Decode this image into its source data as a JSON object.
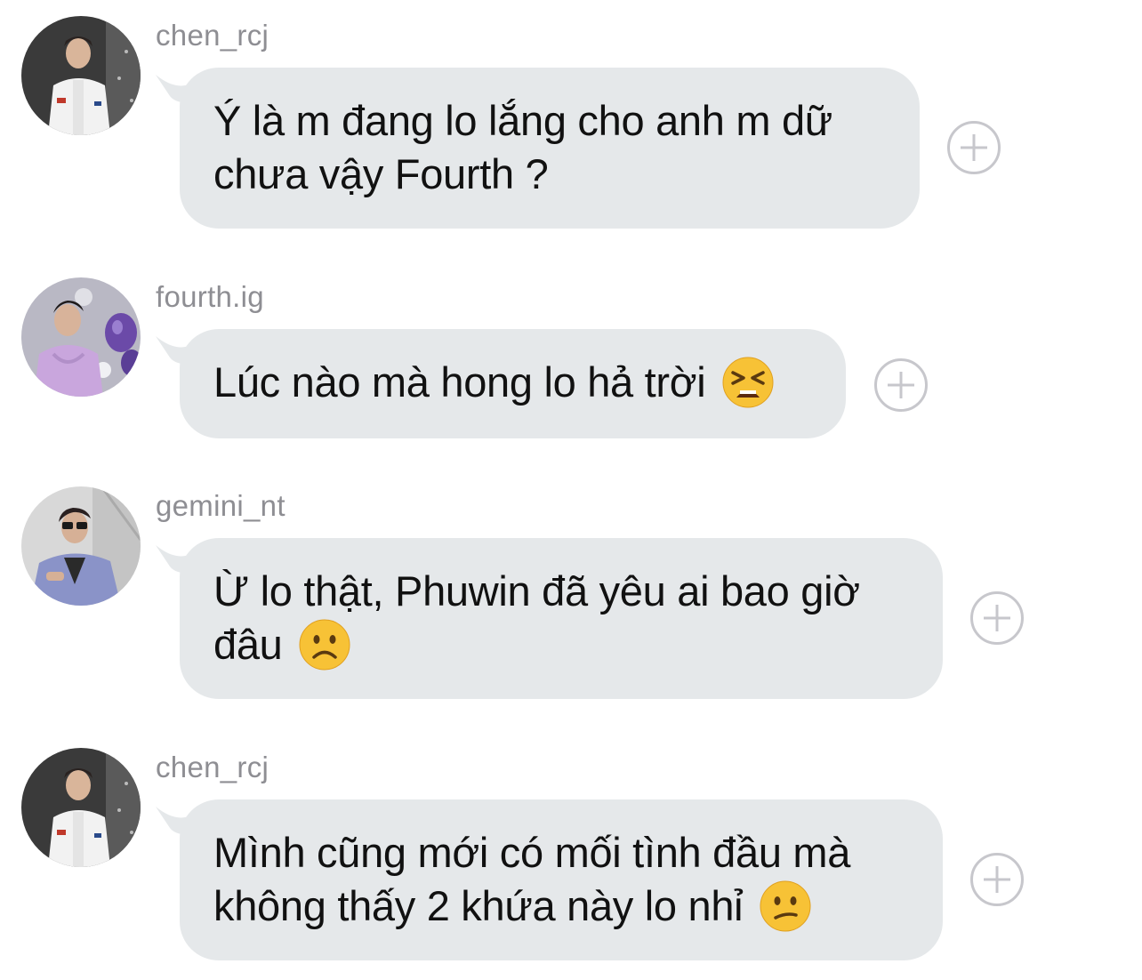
{
  "messages": [
    {
      "username": "chen_rcj",
      "avatar": "person-white-shirt-avatar",
      "lines": [
        "Ý là m đang lo lắng cho anh m dữ",
        "chưa vậy Fourth ?"
      ],
      "emoji": ""
    },
    {
      "username": "fourth.ig",
      "avatar": "person-purple-hoodie-balloons-avatar",
      "lines": [
        "Lúc nào mà hong lo hả trời"
      ],
      "emoji": "tired-face-emoji"
    },
    {
      "username": "gemini_nt",
      "avatar": "person-sunglasses-blue-suit-avatar",
      "lines": [
        "Ừ lo thật, Phuwin đã yêu ai bao giờ",
        "đâu"
      ],
      "emoji": "frowning-face-emoji"
    },
    {
      "username": "chen_rcj",
      "avatar": "person-white-shirt-avatar",
      "lines": [
        "Mình cũng mới có mối tình đầu mà",
        "không thấy 2 khứa này lo nhỉ"
      ],
      "emoji": "confused-face-emoji"
    }
  ],
  "colors": {
    "bubble": "#e5e8ea",
    "username": "#8e8e93",
    "add_button": "#c7c7cc",
    "text": "#111111"
  },
  "add_button_icon": "plus-circle-icon"
}
